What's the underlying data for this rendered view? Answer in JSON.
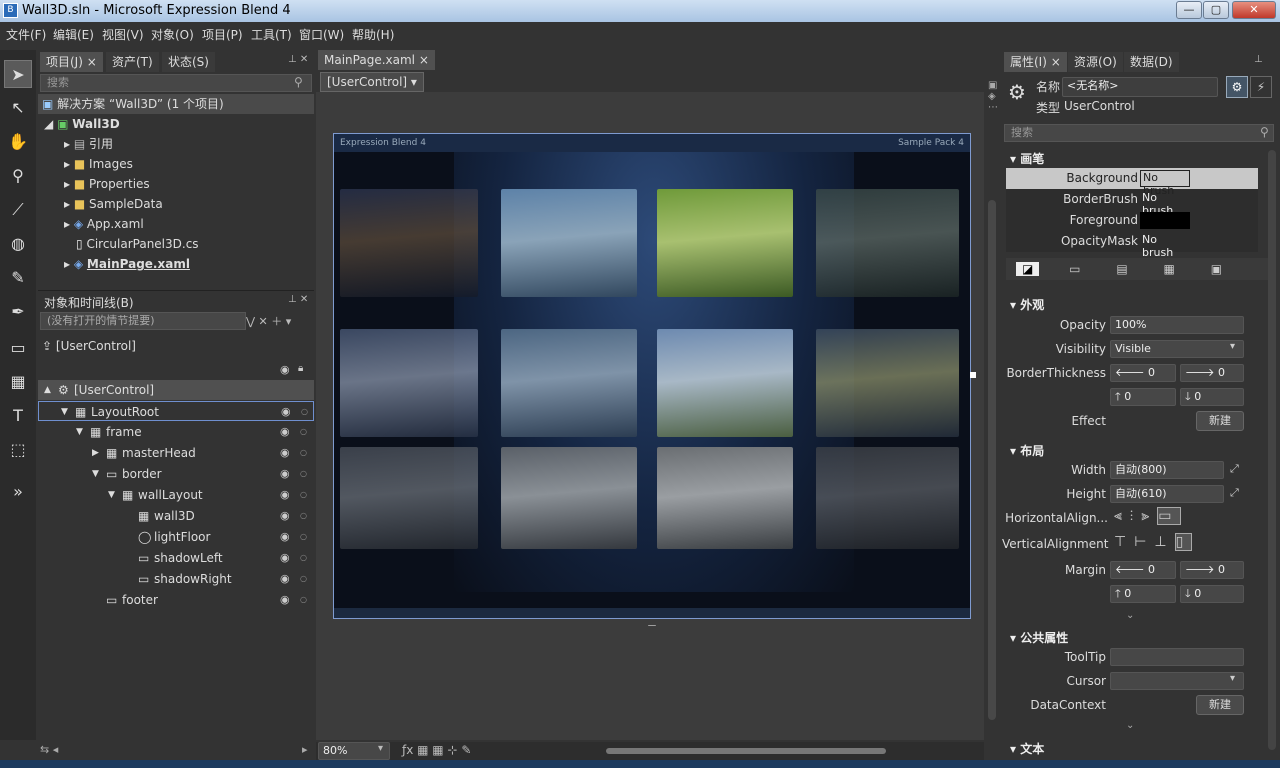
{
  "window": {
    "title": "Wall3D.sln - Microsoft Expression Blend 4",
    "minimize": "—",
    "maximize": "▢",
    "close": "✕"
  },
  "menu": [
    "文件(F)",
    "编辑(E)",
    "视图(V)",
    "对象(O)",
    "项目(P)",
    "工具(T)",
    "窗口(W)",
    "帮助(H)"
  ],
  "tools": [
    "arrow-select",
    "direct-select",
    "hand-pan",
    "zoom",
    "eyedropper",
    "paint-bucket",
    "pencil",
    "pen",
    "rectangle",
    "grid",
    "text",
    "asset-brush",
    "more"
  ],
  "project_panel": {
    "tabs": [
      "项目(J)",
      "资产(T)",
      "状态(S)"
    ],
    "search_placeholder": "搜索",
    "solution": "解决方案 “Wall3D” (1 个项目)",
    "project": "Wall3D",
    "items": [
      {
        "label": "引用",
        "type": "ref",
        "expander": true
      },
      {
        "label": "Images",
        "type": "folder",
        "expander": true
      },
      {
        "label": "Properties",
        "type": "folder",
        "expander": true
      },
      {
        "label": "SampleData",
        "type": "folder",
        "expander": true
      },
      {
        "label": "App.xaml",
        "type": "xaml",
        "expander": true
      },
      {
        "label": "CircularPanel3D.cs",
        "type": "cs",
        "expander": false
      },
      {
        "label": "MainPage.xaml",
        "type": "xaml",
        "expander": true,
        "bold": true
      }
    ]
  },
  "objects_panel": {
    "title": "对象和时间线(B)",
    "storyboard": "(没有打开的情节提要)",
    "scope": "[UserControl]",
    "tree": [
      {
        "label": "[UserControl]",
        "level": 0,
        "exp": "▲"
      },
      {
        "label": "LayoutRoot",
        "level": 1,
        "exp": "▼",
        "icon": "grid"
      },
      {
        "label": "frame",
        "level": 2,
        "exp": "▼",
        "icon": "grid"
      },
      {
        "label": "masterHead",
        "level": 3,
        "exp": "▶",
        "icon": "grid"
      },
      {
        "label": "border",
        "level": 3,
        "exp": "▼",
        "icon": "rect"
      },
      {
        "label": "wallLayout",
        "level": 4,
        "exp": "▼",
        "icon": "grid"
      },
      {
        "label": "wall3D",
        "level": 5,
        "exp": "",
        "icon": "grid"
      },
      {
        "label": "lightFloor",
        "level": 5,
        "exp": "",
        "icon": "ellipse"
      },
      {
        "label": "shadowLeft",
        "level": 5,
        "exp": "",
        "icon": "rect"
      },
      {
        "label": "shadowRight",
        "level": 5,
        "exp": "",
        "icon": "rect"
      },
      {
        "label": "footer",
        "level": 3,
        "exp": "",
        "icon": "rect"
      }
    ]
  },
  "document": {
    "tab": "MainPage.xaml",
    "breadcrumb": "[UserControl]",
    "artboard_left_label": "Expression Blend 4",
    "artboard_right_label": "Sample Pack 4",
    "zoom": "80%"
  },
  "properties_panel": {
    "tabs": [
      "属性(I)",
      "资源(O)",
      "数据(D)"
    ],
    "name_label": "名称",
    "name_value": "<无名称>",
    "type_label": "类型",
    "type_value": "UserControl",
    "search_placeholder": "搜索",
    "brushes_section": "画笔",
    "brushes": [
      {
        "label": "Background",
        "value": "No brush",
        "highlight": true
      },
      {
        "label": "BorderBrush",
        "value": "No brush"
      },
      {
        "label": "Foreground",
        "value": ""
      },
      {
        "label": "OpacityMask",
        "value": "No brush"
      }
    ],
    "appearance_section": "外观",
    "opacity_label": "Opacity",
    "opacity_value": "100%",
    "visibility_label": "Visibility",
    "visibility_value": "Visible",
    "border_label": "BorderThickness",
    "border_values": [
      "0",
      "0",
      "0",
      "0"
    ],
    "effect_label": "Effect",
    "new_label": "新建",
    "layout_section": "布局",
    "width_label": "Width",
    "width_value": "自动(800)",
    "height_label": "Height",
    "height_value": "自动(610)",
    "halign_label": "HorizontalAlign...",
    "valign_label": "VerticalAlignment",
    "margin_label": "Margin",
    "margin_values": [
      "0",
      "0",
      "0",
      "0"
    ],
    "common_section": "公共属性",
    "tooltip_label": "ToolTip",
    "cursor_label": "Cursor",
    "datacontext_label": "DataContext",
    "text_section": "文本"
  },
  "colors": {
    "accent": "#7f9bd0",
    "panel": "#333333",
    "field": "#474747"
  }
}
